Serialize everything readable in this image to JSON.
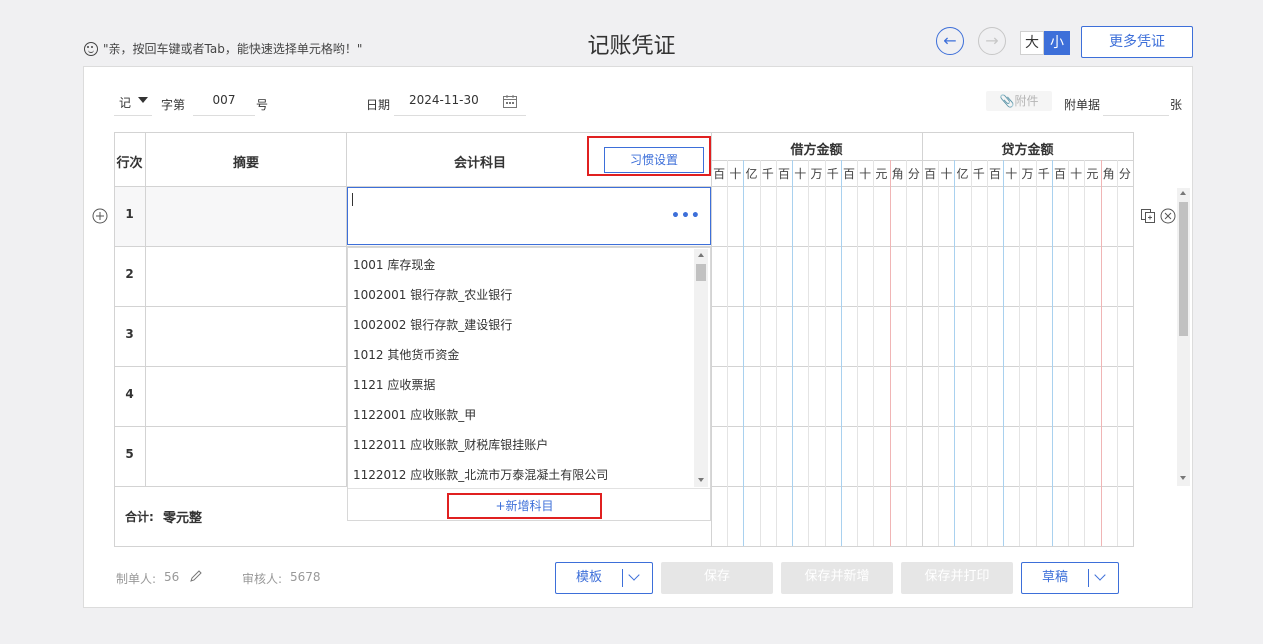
{
  "header": {
    "hint": "\"亲，按回车键或者Tab，能快速选择单元格哟！\"",
    "title": "记账凭证",
    "size_big": "大",
    "size_small": "小",
    "more_vouchers": "更多凭证"
  },
  "voucher": {
    "type": "记",
    "zi_label": "字第",
    "number": "007",
    "hao_label": "号",
    "date_label": "日期",
    "date_value": "2024-11-30",
    "attachment_label": "附件",
    "attach_doc_label": "附单据",
    "zhang_label": "张"
  },
  "table": {
    "col_row": "行次",
    "col_summary": "摘要",
    "col_account": "会计科目",
    "habit_settings": "习惯设置",
    "debit_header": "借方金额",
    "credit_header": "贷方金额",
    "digits": [
      "百",
      "十",
      "亿",
      "千",
      "百",
      "十",
      "万",
      "千",
      "百",
      "十",
      "元",
      "角",
      "分"
    ],
    "rows": [
      "1",
      "2",
      "3",
      "4",
      "5"
    ],
    "total_label": "合计:",
    "total_value": "零元整"
  },
  "dropdown": {
    "options": [
      "1001 库存现金",
      "1002001 银行存款_农业银行",
      "1002002 银行存款_建设银行",
      "1012 其他货币资金",
      "1121 应收票据",
      "1122001 应收账款_甲",
      "1122011 应收账款_财税库银挂账户",
      "1122012 应收账款_北流市万泰混凝土有限公司"
    ],
    "add_account": "+新增科目"
  },
  "footer": {
    "maker_label": "制单人:",
    "maker_value": "56",
    "reviewer_label": "审核人:",
    "reviewer_value": "5678",
    "template": "模板",
    "save": "保存",
    "save_new": "保存并新增",
    "save_print": "保存并打印",
    "draft": "草稿"
  },
  "colors": {
    "accent": "#3d6fd9",
    "highlight_red": "#e02020",
    "disabled": "#e6e6e6"
  }
}
